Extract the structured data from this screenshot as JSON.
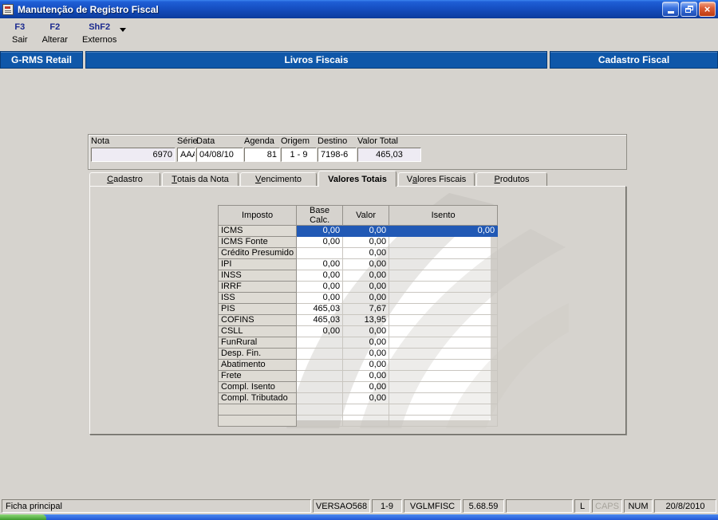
{
  "window": {
    "title": "Manutenção de Registro Fiscal",
    "controls": [
      "minimize",
      "restore",
      "close"
    ]
  },
  "icons": {
    "close_glyph": "×"
  },
  "toolbar": {
    "buttons": [
      {
        "key": "F3",
        "label": "Sair",
        "has_dropdown": false
      },
      {
        "key": "F2",
        "label": "Alterar",
        "has_dropdown": false
      },
      {
        "key": "ShF2",
        "label": "Externos",
        "has_dropdown": true
      }
    ]
  },
  "banner": {
    "left": "G-RMS Retail",
    "center": "Livros Fiscais",
    "right": "Cadastro Fiscal"
  },
  "header_fields": [
    {
      "label": "Nota",
      "value": "6970"
    },
    {
      "label": "Série",
      "value": "AAA"
    },
    {
      "label": "Data",
      "value": "04/08/10"
    },
    {
      "label": "Agenda",
      "value": "81"
    },
    {
      "label": "Origem",
      "value": "1 - 9"
    },
    {
      "label": "Destino",
      "value": "7198-6"
    },
    {
      "label": "Valor Total",
      "value": "465,03"
    }
  ],
  "tabs": [
    {
      "label": "Cadastro",
      "active": false,
      "accel": 0
    },
    {
      "label": "Totais da Nota",
      "active": false,
      "accel": 0
    },
    {
      "label": "Vencimento",
      "active": false,
      "accel": 0
    },
    {
      "label": "Valores Totais",
      "active": true,
      "accel": null
    },
    {
      "label": "Valores Fiscais",
      "active": false,
      "accel": 1
    },
    {
      "label": "Produtos",
      "active": false,
      "accel": 0
    }
  ],
  "tax_table": {
    "columns": [
      "Imposto",
      "Base Calc.",
      "Valor",
      "Isento"
    ],
    "rows": [
      {
        "imposto": "ICMS",
        "base": "0,00",
        "valor": "0,00",
        "isento": "0,00",
        "selected": true
      },
      {
        "imposto": "ICMS Fonte",
        "base": "0,00",
        "valor": "0,00",
        "isento": ""
      },
      {
        "imposto": "Crédito Presumido",
        "base": "",
        "valor": "0,00",
        "isento": ""
      },
      {
        "imposto": "IPI",
        "base": "0,00",
        "valor": "0,00",
        "isento": ""
      },
      {
        "imposto": "INSS",
        "base": "0,00",
        "valor": "0,00",
        "isento": ""
      },
      {
        "imposto": "IRRF",
        "base": "0,00",
        "valor": "0,00",
        "isento": ""
      },
      {
        "imposto": "ISS",
        "base": "0,00",
        "valor": "0,00",
        "isento": ""
      },
      {
        "imposto": "PIS",
        "base": "465,03",
        "valor": "7,67",
        "isento": ""
      },
      {
        "imposto": "COFINS",
        "base": "465,03",
        "valor": "13,95",
        "isento": ""
      },
      {
        "imposto": "CSLL",
        "base": "0,00",
        "valor": "0,00",
        "isento": ""
      },
      {
        "imposto": "FunRural",
        "base": "",
        "valor": "0,00",
        "isento": ""
      },
      {
        "imposto": "Desp. Fin.",
        "base": "",
        "valor": "0,00",
        "isento": ""
      },
      {
        "imposto": "Abatimento",
        "base": "",
        "valor": "0,00",
        "isento": ""
      },
      {
        "imposto": "Frete",
        "base": "",
        "valor": "0,00",
        "isento": ""
      },
      {
        "imposto": "Compl. Isento",
        "base": "",
        "valor": "0,00",
        "isento": ""
      },
      {
        "imposto": "Compl. Tributado",
        "base": "",
        "valor": "0,00",
        "isento": ""
      },
      {
        "imposto": "",
        "base": "",
        "valor": "",
        "isento": ""
      },
      {
        "imposto": "",
        "base": "",
        "valor": "",
        "isento": ""
      }
    ]
  },
  "statusbar": {
    "message": "Ficha principal",
    "panels": [
      {
        "text": "VERSAO568",
        "dim": false
      },
      {
        "text": "1-9",
        "dim": false
      },
      {
        "text": "VGLMFISC",
        "dim": false
      },
      {
        "text": "5.68.59",
        "dim": false
      },
      {
        "text": "",
        "dim": false
      },
      {
        "text": "L",
        "dim": false
      },
      {
        "text": "CAPS",
        "dim": true
      },
      {
        "text": "NUM",
        "dim": false
      },
      {
        "text": "20/8/2010",
        "dim": false
      }
    ]
  },
  "colors": {
    "titlebar_blue": "#164fc2",
    "banner_blue": "#0f57a9",
    "selection_blue": "#2159b5",
    "close_button_red": "#dd5f38",
    "window_gray": "#d6d3ce"
  }
}
